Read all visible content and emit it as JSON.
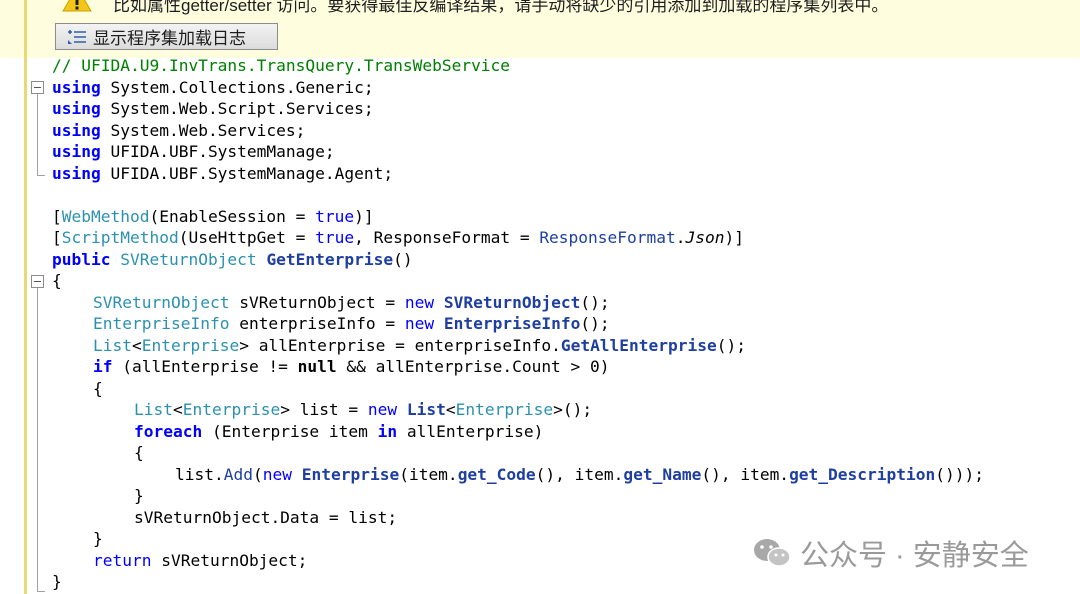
{
  "warning": {
    "text": "比如属性getter/setter 访问。要获得最佳反编译结果，请手动将缺少的引用添加到加载的程序集列表中。"
  },
  "toolbar": {
    "show_assembly_log_label": "显示程序集加载日志"
  },
  "code": {
    "namespace_comment": "// UFIDA.U9.InvTrans.TransQuery.TransWebService",
    "usings": [
      "System.Collections.Generic;",
      "System.Web.Script.Services;",
      "System.Web.Services;",
      "UFIDA.UBF.SystemManage;",
      "UFIDA.UBF.SystemManage.Agent;"
    ],
    "kw_using": "using",
    "attr1": {
      "open": "[",
      "name": "WebMethod",
      "args": "(EnableSession = ",
      "val": "true",
      "close": ")]"
    },
    "attr2": {
      "open": "[",
      "name": "ScriptMethod",
      "args": "(UseHttpGet = ",
      "val": "true",
      "mid": ", ResponseFormat = ",
      "enum_type": "ResponseFormat",
      "dot": ".",
      "enum_val": "Json",
      "close": ")]"
    },
    "signature": {
      "kw": "public",
      "type": "SVReturnObject",
      "name": "GetEnterprise",
      "params": "()"
    },
    "open_brace": "{",
    "close_brace": "}",
    "l_decl1": {
      "type": "SVReturnObject",
      "var": " sVReturnObject = ",
      "kw": "new",
      "ctor": "SVReturnObject",
      "end": "();"
    },
    "l_decl2": {
      "type": "EnterpriseInfo",
      "var": " enterpriseInfo = ",
      "kw": "new",
      "ctor": "EnterpriseInfo",
      "end": "();"
    },
    "l_decl3": {
      "type": "List",
      "lt": "<",
      "inner": "Enterprise",
      "gt": ">",
      "var": " allEnterprise = enterpriseInfo.",
      "call": "GetAllEnterprise",
      "end": "();"
    },
    "l_if": {
      "kw": "if",
      "cond1": " (allEnterprise != ",
      "null": "null",
      "cond2": " && allEnterprise.Count > ",
      "num": "0",
      "end": ")"
    },
    "l_list": {
      "type": "List",
      "lt": "<",
      "inner": "Enterprise",
      "gt": ">",
      "var": " list = ",
      "kw": "new",
      "ctor": "List",
      "ctor_inner": "Enterprise",
      "end": "();"
    },
    "l_foreach": {
      "kw": "foreach",
      "a": " (Enterprise item ",
      "in": "in",
      "b": " allEnterprise)"
    },
    "l_add": {
      "a": "list.",
      "add": "Add",
      "p": "(",
      "kw": "new",
      "ctor": "Enterprise",
      "b": "(item.",
      "m1": "get_Code",
      "c": "(), item.",
      "m2": "get_Name",
      "d": "(), item.",
      "m3": "get_Description",
      "e": "()));"
    },
    "l_assign": "sVReturnObject.Data = list;",
    "l_return": {
      "kw": "return",
      "rest": " sVReturnObject;"
    }
  },
  "watermark": {
    "text": "公众号 · 安静安全"
  }
}
